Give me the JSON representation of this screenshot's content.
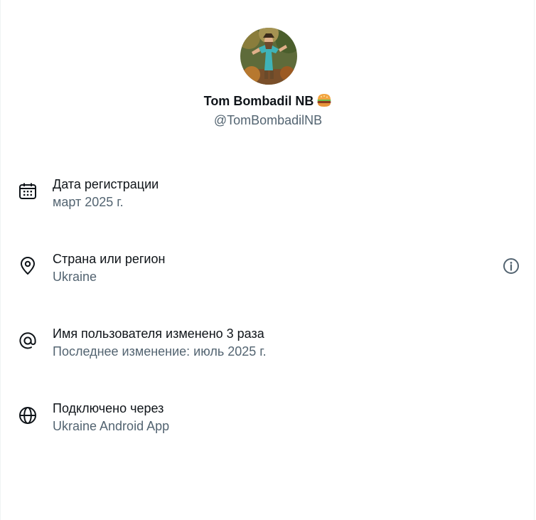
{
  "profile": {
    "display_name": "Tom Bombadil NB",
    "name_emoji": "hamburger-emoji",
    "handle": "@TomBombadilNB",
    "avatar": "avatar-illustration"
  },
  "about": {
    "items": [
      {
        "icon": "calendar-icon",
        "title": "Дата регистрации",
        "value": "март 2025 г."
      },
      {
        "icon": "location-pin-icon",
        "title": "Страна или регион",
        "value": "Ukraine",
        "action_icon": "info-icon"
      },
      {
        "icon": "at-sign-icon",
        "title": "Имя пользователя изменено 3 раза",
        "value": "Последнее изменение: июль 2025 г."
      },
      {
        "icon": "globe-icon",
        "title": "Подключено через",
        "value": "Ukraine Android App"
      }
    ]
  },
  "colors": {
    "primary_text": "#0f1419",
    "secondary_text": "#536471",
    "border": "#eff3f4"
  }
}
